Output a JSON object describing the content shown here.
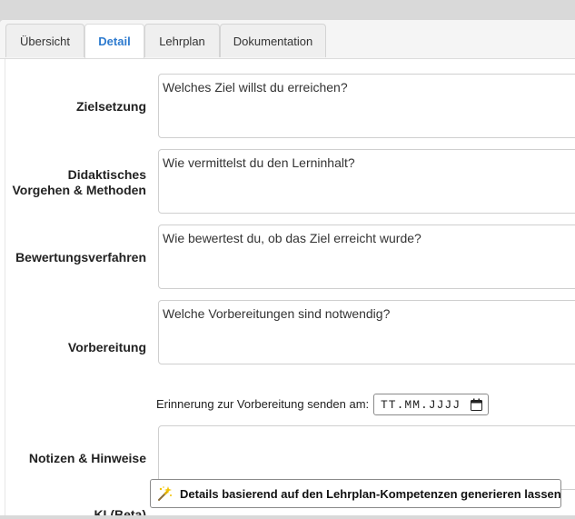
{
  "tabs": [
    {
      "label": "Übersicht",
      "active": false
    },
    {
      "label": "Detail",
      "active": true
    },
    {
      "label": "Lehrplan",
      "active": false
    },
    {
      "label": "Dokumentation",
      "active": false
    }
  ],
  "fields": {
    "zielsetzung": {
      "label": "Zielsetzung",
      "placeholder": "Welches Ziel willst du erreichen?"
    },
    "didaktik": {
      "label_line1": "Didaktisches",
      "label_line2": "Vorgehen & Methoden",
      "placeholder": "Wie vermittelst du den Lerninhalt?"
    },
    "bewertung": {
      "label": "Bewertungsverfahren",
      "placeholder": "Wie bewertest du, ob das Ziel erreicht wurde?"
    },
    "vorbereitung": {
      "label": "Vorbereitung",
      "placeholder": "Welche Vorbereitungen sind notwendig?"
    },
    "notizen": {
      "label": "Notizen & Hinweise",
      "placeholder": ""
    }
  },
  "reminder": {
    "label": "Erinnerung zur Vorbereitung senden am:",
    "date_placeholder": "TT.MM.JJJJ"
  },
  "ki": {
    "label": "KI (Beta)",
    "button_label": "Details basierend auf den Lehrplan-Kompetenzen generieren lassen"
  },
  "colors": {
    "accent": "#2e7bcf",
    "border": "#cfcfcf"
  },
  "icons": {
    "date": "calendar-icon",
    "ki": "magic-wand-icon"
  }
}
